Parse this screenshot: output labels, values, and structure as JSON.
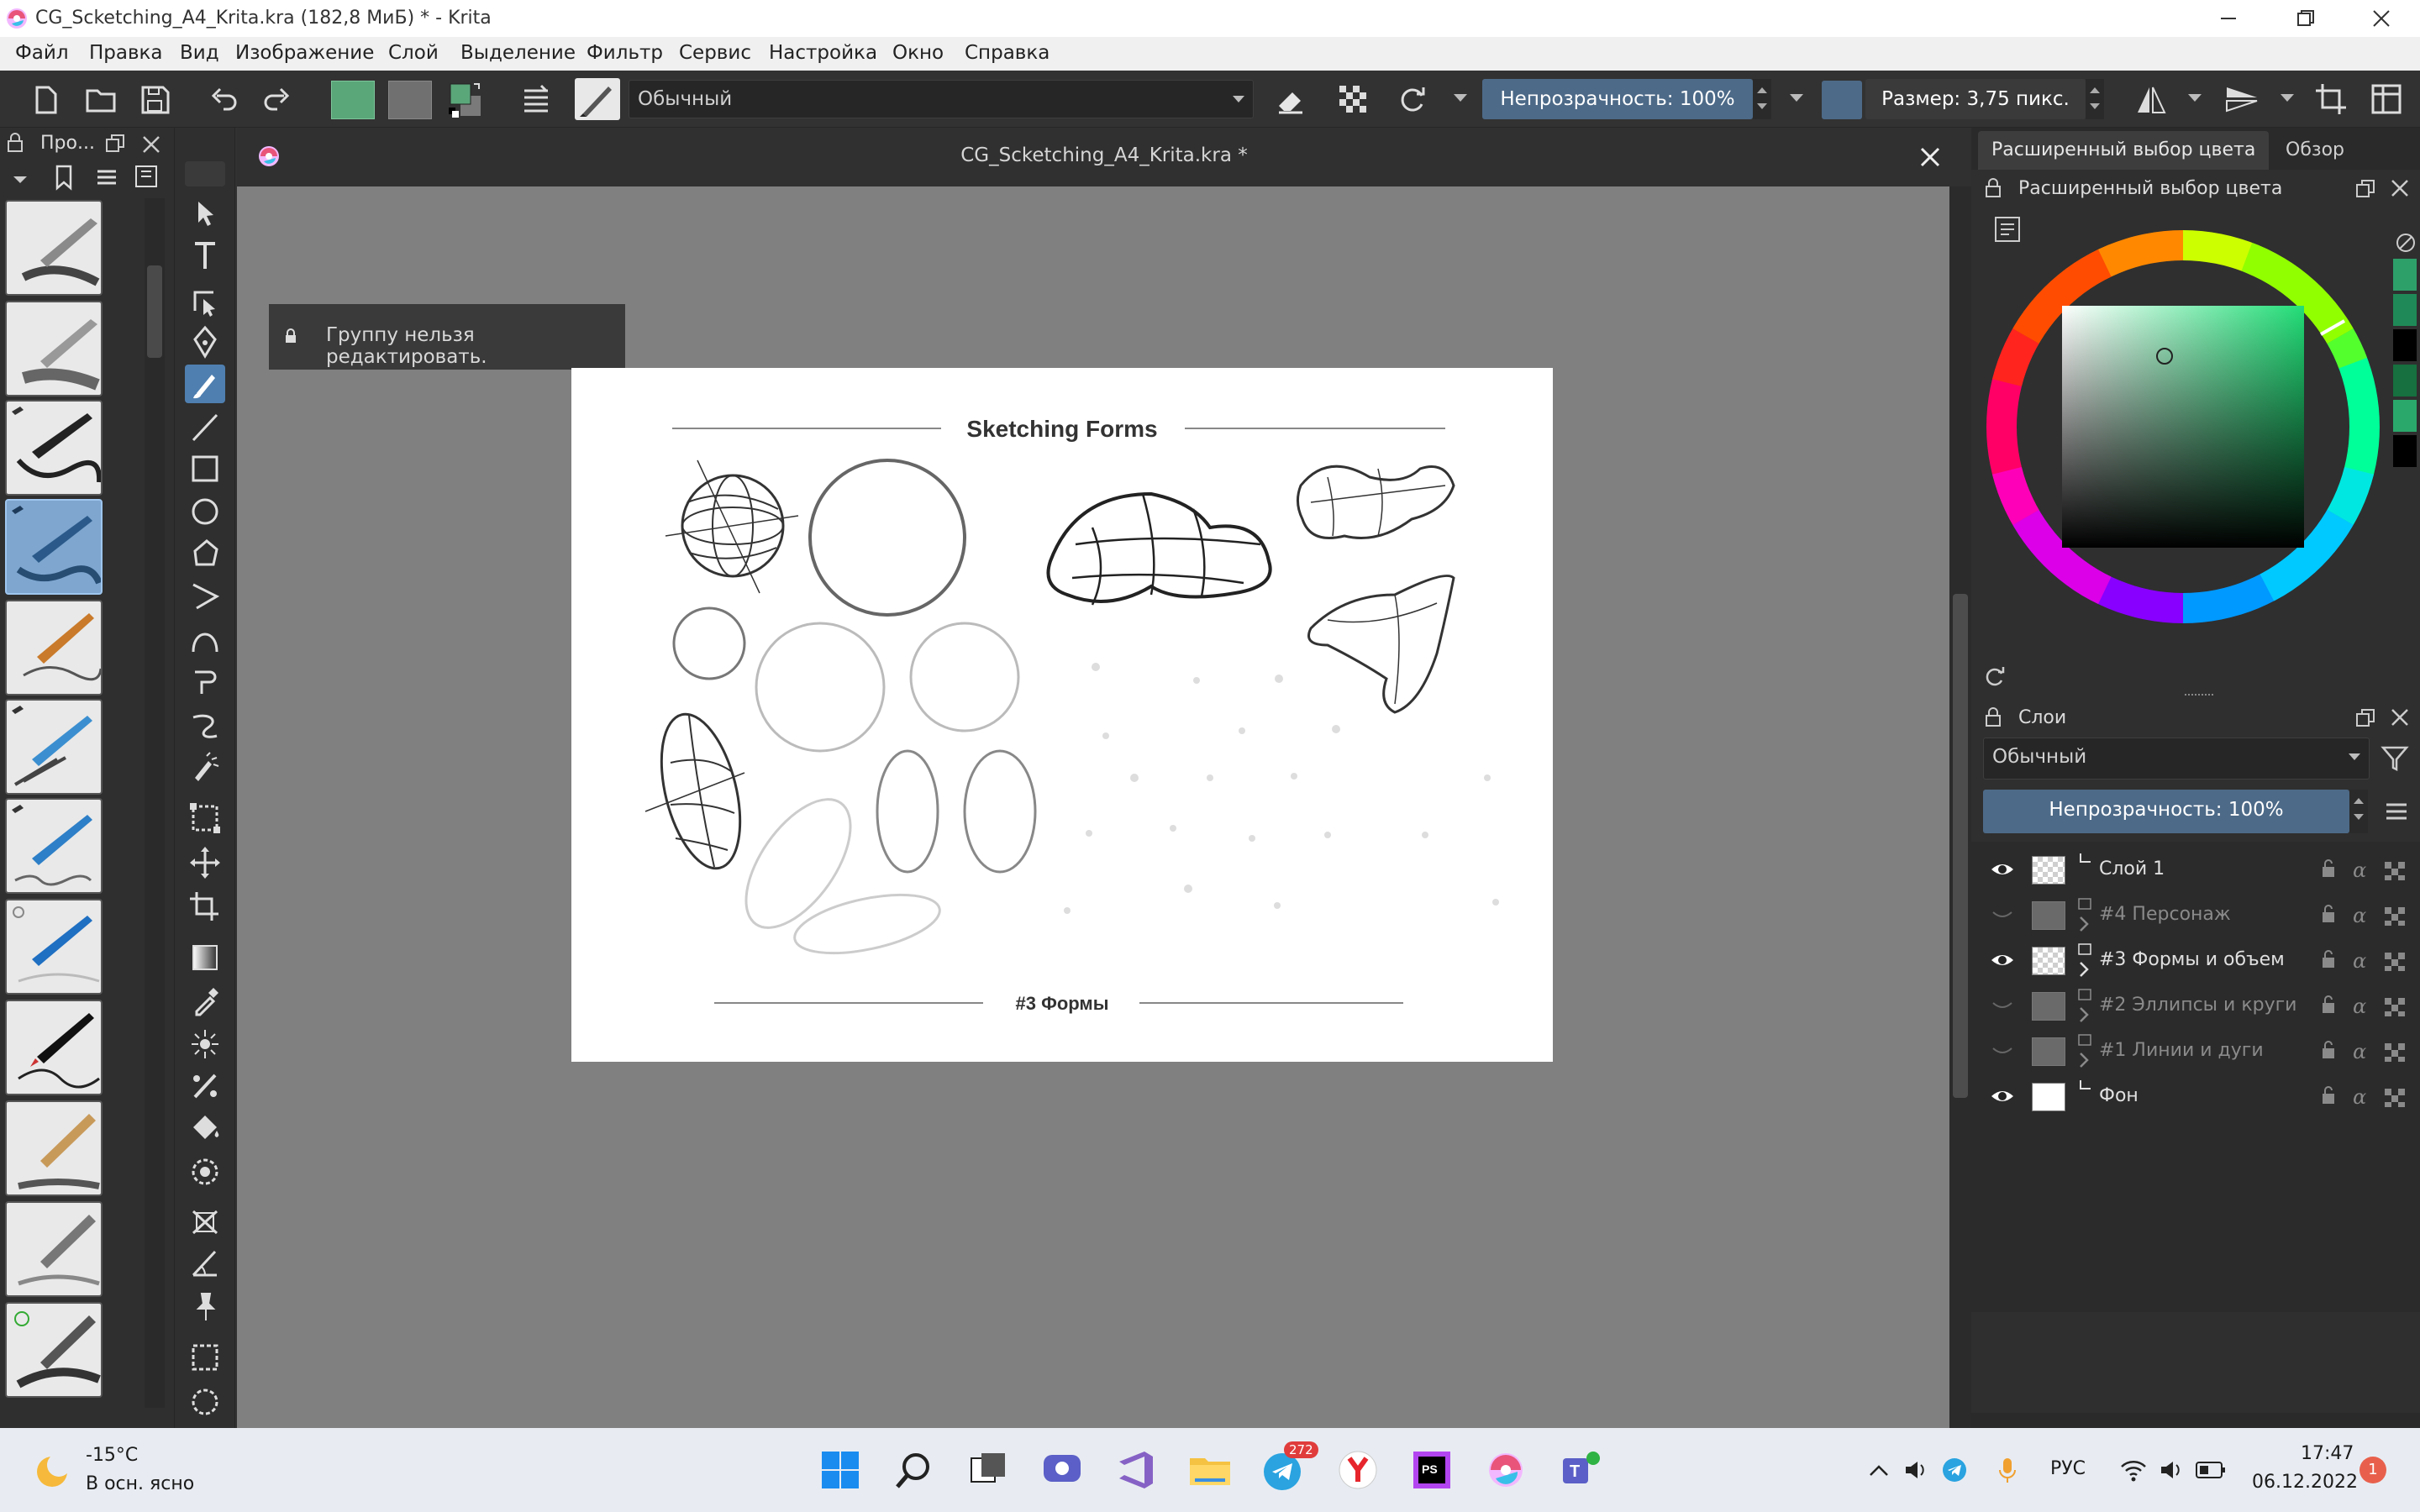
{
  "window": {
    "title": "CG_Scketching_A4_Krita.kra (182,8 МиБ)  * - Krita"
  },
  "menu": [
    "Файл",
    "Правка",
    "Вид",
    "Изображение",
    "Слой",
    "Выделение",
    "Фильтр",
    "Сервис",
    "Настройка",
    "Окно",
    "Справка"
  ],
  "toolbar": {
    "blend_mode": "Обычный",
    "opacity_label": "Непрозрачность: 100%",
    "size_label": "Размер: 3,75 пикс.",
    "fg_color": "#5aa77a",
    "bg_color": "#7a7a7a",
    "size_color": "#4d6a88"
  },
  "brush_panel": {
    "title": "Про..."
  },
  "document": {
    "tab_title": "CG_Scketching_A4_Krita.kra *",
    "toast": "Группу нельзя редактировать.",
    "canvas_title": "Sketching Forms",
    "canvas_footer": "#3 Формы"
  },
  "right_tabs": [
    "Расширенный выбор цвета",
    "Обзор"
  ],
  "color_panel": {
    "title": "Расширенный выбор цвета",
    "current_hue": "#22dd77",
    "history_colors": [
      "#2da06a",
      "#1f8a57",
      "#000000",
      "#16703f",
      "#2aa86b",
      "#000000"
    ]
  },
  "layers_panel": {
    "title": "Слои",
    "blend_mode": "Обычный",
    "opacity_label": "Непрозрачность:  100%",
    "layers": [
      {
        "name": "Слой 1",
        "visible": true,
        "group": false,
        "thumb": "transparent"
      },
      {
        "name": "#4 Персонаж",
        "visible": false,
        "group": true,
        "thumb": "gray"
      },
      {
        "name": "#3 Формы и объем",
        "visible": true,
        "group": true,
        "thumb": "transparent"
      },
      {
        "name": "#2 Эллипсы и круги",
        "visible": false,
        "group": true,
        "thumb": "gray"
      },
      {
        "name": "#1 Линии и дуги",
        "visible": false,
        "group": true,
        "thumb": "gray"
      },
      {
        "name": "Фон",
        "visible": true,
        "group": false,
        "thumb": "white"
      }
    ]
  },
  "taskbar": {
    "weather_temp": "-15°C",
    "weather_text": "В осн. ясно",
    "telegram_badge": "272",
    "language": "РУС",
    "time": "17:47",
    "date": "06.12.2022",
    "notifications": "1"
  }
}
